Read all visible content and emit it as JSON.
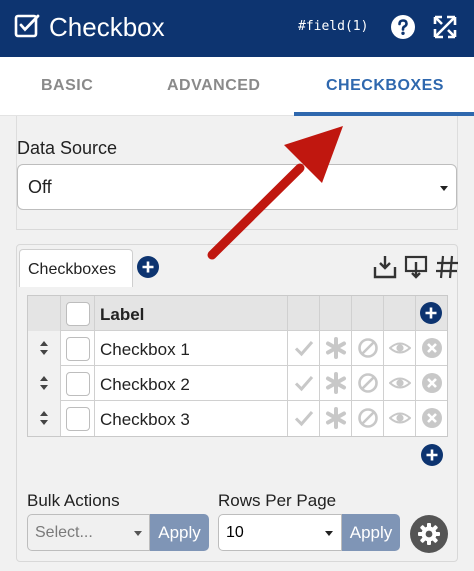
{
  "header": {
    "title": "Checkbox",
    "field_ref": "#field(1)",
    "icons": [
      "check-square-icon",
      "help-icon",
      "expand-icon"
    ],
    "bg_color": "#0d3470"
  },
  "tabs": [
    {
      "label": "BASIC",
      "active": false
    },
    {
      "label": "ADVANCED",
      "active": false
    },
    {
      "label": "CHECKBOXES",
      "active": true
    }
  ],
  "data_source": {
    "label": "Data Source",
    "value": "Off"
  },
  "checkboxes_panel": {
    "tab_label": "Checkboxes",
    "tool_icons": [
      "import-icon",
      "import-dropdown-icon",
      "hash-icon"
    ],
    "table": {
      "header_label": "Label",
      "rows": [
        {
          "label": "Checkbox 1"
        },
        {
          "label": "Checkbox 2"
        },
        {
          "label": "Checkbox 3"
        }
      ],
      "row_action_icons": [
        "check-icon",
        "asterisk-icon",
        "disable-icon",
        "eye-icon",
        "remove-icon"
      ]
    },
    "bulk_actions": {
      "label": "Bulk Actions",
      "placeholder": "Select...",
      "apply": "Apply"
    },
    "rows_per_page": {
      "label": "Rows Per Page",
      "value": "10",
      "apply": "Apply"
    }
  },
  "colors": {
    "accent": "#2f68ae",
    "apply_button": "#7f95b6",
    "annotation_arrow": "#c0170f"
  }
}
